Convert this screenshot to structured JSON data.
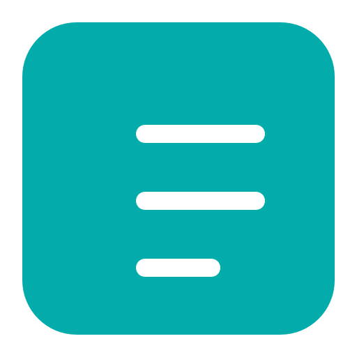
{
  "icon": {
    "name": "menu-lines-icon",
    "background_color": "#04abab",
    "glyph_color": "#ffffff",
    "page_background": "#ffffff"
  }
}
